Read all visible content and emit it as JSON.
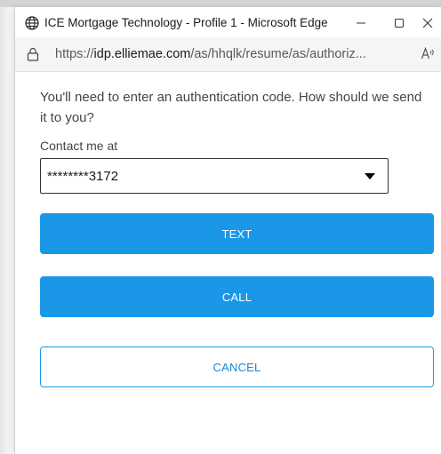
{
  "window": {
    "title": "ICE Mortgage Technology - Profile 1 - Microsoft Edge",
    "minimize_icon": "minimize-icon",
    "maximize_icon": "maximize-icon",
    "close_icon": "close-icon"
  },
  "addressbar": {
    "scheme": "https://",
    "domain": "idp.elliemae.com",
    "path": "/as/hhqlk/resume/as/authoriz..."
  },
  "auth": {
    "prompt": "You'll need to enter an authentication code. How should we send it to you?",
    "contact_label": "Contact me at",
    "contact_value": "********3172",
    "text_button": "TEXT",
    "call_button": "CALL",
    "cancel_button": "CANCEL"
  },
  "colors": {
    "primary": "#1a97e6",
    "cancel_text": "#1a86d4"
  }
}
